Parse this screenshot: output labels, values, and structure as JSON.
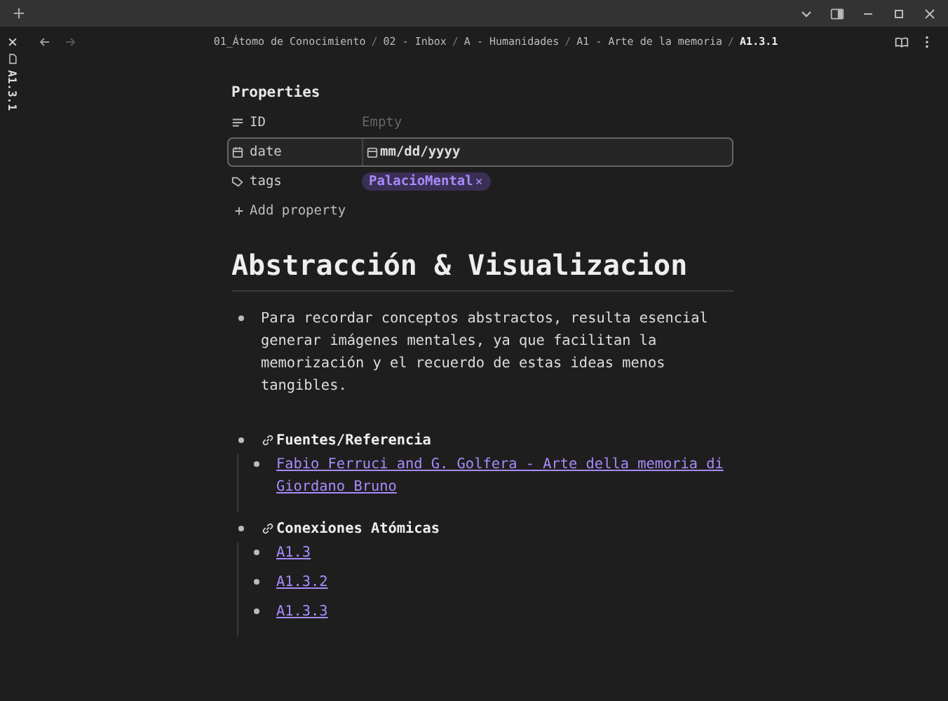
{
  "breadcrumb": {
    "separator": "/",
    "items": [
      {
        "label": "01_Átomo de Conocimiento",
        "current": false
      },
      {
        "label": "02 - Inbox",
        "current": false
      },
      {
        "label": "A - Humanidades",
        "current": false
      },
      {
        "label": "A1 - Arte de la memoria",
        "current": false
      },
      {
        "label": "A1.3.1",
        "current": true
      }
    ]
  },
  "side_tab": {
    "label": "A1.3.1"
  },
  "properties": {
    "title": "Properties",
    "items": [
      {
        "kind": "text",
        "name": "ID",
        "placeholder": "Empty",
        "focused": false
      },
      {
        "kind": "date",
        "name": "date",
        "placeholder": "mm/dd/yyyy",
        "focused": true
      },
      {
        "kind": "tags",
        "name": "tags",
        "tags": [
          "PalacioMental"
        ],
        "focused": false
      }
    ],
    "add_label": "Add property"
  },
  "heading": "Abstracción & Visualizacion",
  "paragraph": "Para recordar conceptos abstractos, resulta esencial generar imágenes mentales, ya que facilitan la memorización y el recuerdo de estas ideas menos tangibles.",
  "sections": [
    {
      "title": "Fuentes/Referencia",
      "links": [
        "Fabio Ferruci and G. Golfera - Arte della memoria di Giordano Bruno"
      ]
    },
    {
      "title": "Conexiones Atómicas",
      "links": [
        "A1.3",
        "A1.3.2",
        "A1.3.3"
      ]
    }
  ]
}
